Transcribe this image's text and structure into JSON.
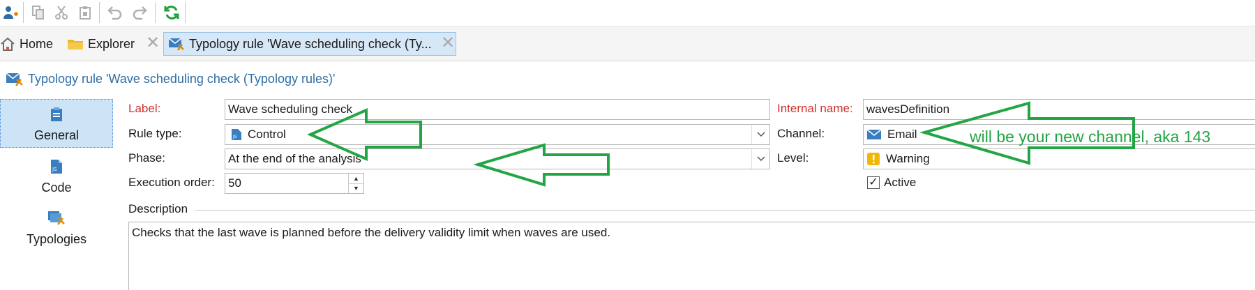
{
  "toolbar": {
    "buttons": [
      {
        "icon": "new-user-icon"
      },
      {
        "icon": "copy-icon"
      },
      {
        "icon": "cut-icon"
      },
      {
        "icon": "paste-icon"
      },
      {
        "icon": "undo-icon"
      },
      {
        "icon": "redo-icon"
      },
      {
        "icon": "refresh-icon"
      }
    ]
  },
  "tabs": [
    {
      "label": "Home",
      "icon": "home-icon"
    },
    {
      "label": "Explorer",
      "icon": "folder-icon"
    },
    {
      "label": "Typology rule 'Wave scheduling check (Ty...",
      "icon": "typology-rule-icon"
    }
  ],
  "page": {
    "title": "Typology rule 'Wave scheduling check (Typology rules)'"
  },
  "nav": {
    "items": [
      {
        "label": "General",
        "icon": "clipboard-icon"
      },
      {
        "label": "Code",
        "icon": "js-file-icon"
      },
      {
        "label": "Typologies",
        "icon": "typologies-icon"
      }
    ]
  },
  "form": {
    "label": {
      "label": "Label:",
      "value": "Wave scheduling check"
    },
    "rule_type": {
      "label": "Rule type:",
      "value": "Control"
    },
    "phase": {
      "label": "Phase:",
      "value": "At the end of the analysis"
    },
    "execution_order": {
      "label": "Execution order:",
      "value": "50"
    },
    "internal_name": {
      "label": "Internal name:",
      "value": "wavesDefinition"
    },
    "channel": {
      "label": "Channel:",
      "value": "Email"
    },
    "level": {
      "label": "Level:",
      "value": "Warning"
    },
    "active": {
      "label": "Active",
      "checked": true
    },
    "description": {
      "label": "Description",
      "value": "Checks that the last wave is planned before the delivery validity limit when waves are used."
    }
  },
  "annotation": {
    "text": "will be your new channel, aka 143",
    "color": "#22a544"
  },
  "colors": {
    "accent": "#2e6da4",
    "required_label": "#d0312d",
    "selected_nav": "#cde4f7",
    "active_tab": "#d6e8f8",
    "warning": "#f2b705"
  }
}
